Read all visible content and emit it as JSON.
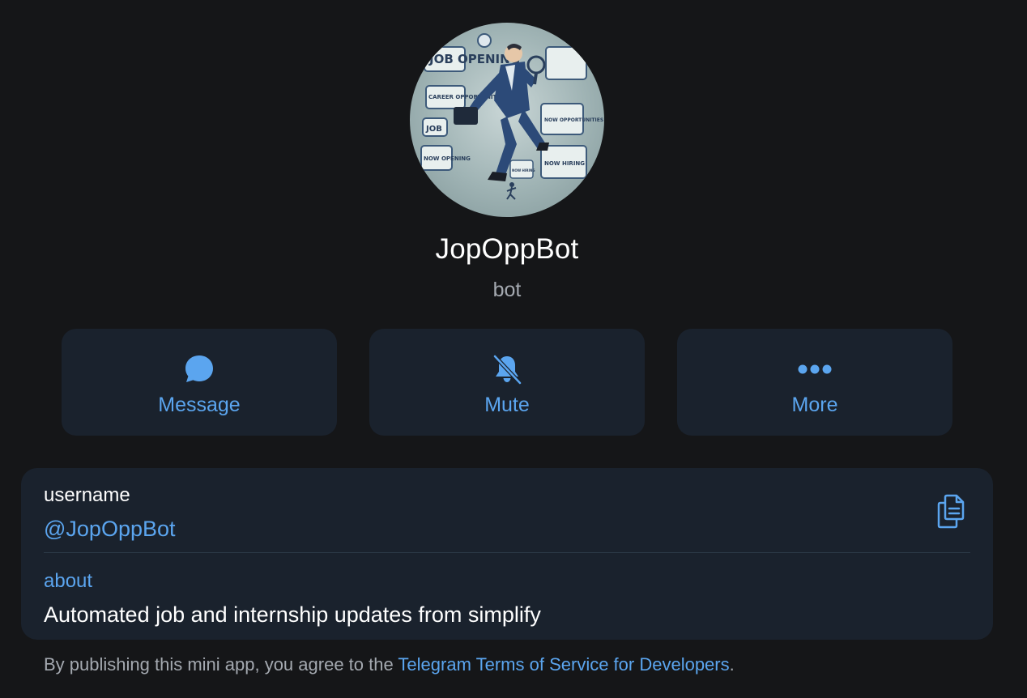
{
  "profile": {
    "name": "JopOppBot",
    "subtitle": "bot",
    "avatar_text": [
      "JOB OPENING",
      "CAREER OPPORTUNITIES",
      "JOB",
      "NOW OPENING",
      "NOW OPPORTUNITIES",
      "NOW HIRING",
      "NOW HIRING"
    ]
  },
  "actions": [
    {
      "label": "Message",
      "icon": "chat-bubble-icon"
    },
    {
      "label": "Mute",
      "icon": "bell-slash-icon"
    },
    {
      "label": "More",
      "icon": "more-dots-icon"
    }
  ],
  "info": {
    "username_label": "username",
    "username_value": "@JopOppBot",
    "about_label": "about",
    "about_value": "Automated job and internship updates from simplify",
    "copy_icon": "copy-icon"
  },
  "footer": {
    "prefix": "By publishing this mini app, you agree to the ",
    "link": "Telegram Terms of Service for Developers",
    "suffix": "."
  },
  "colors": {
    "background": "#151618",
    "card": "#1a222d",
    "accent": "#5ba5ef",
    "secondary_text": "#a4a9b0"
  }
}
